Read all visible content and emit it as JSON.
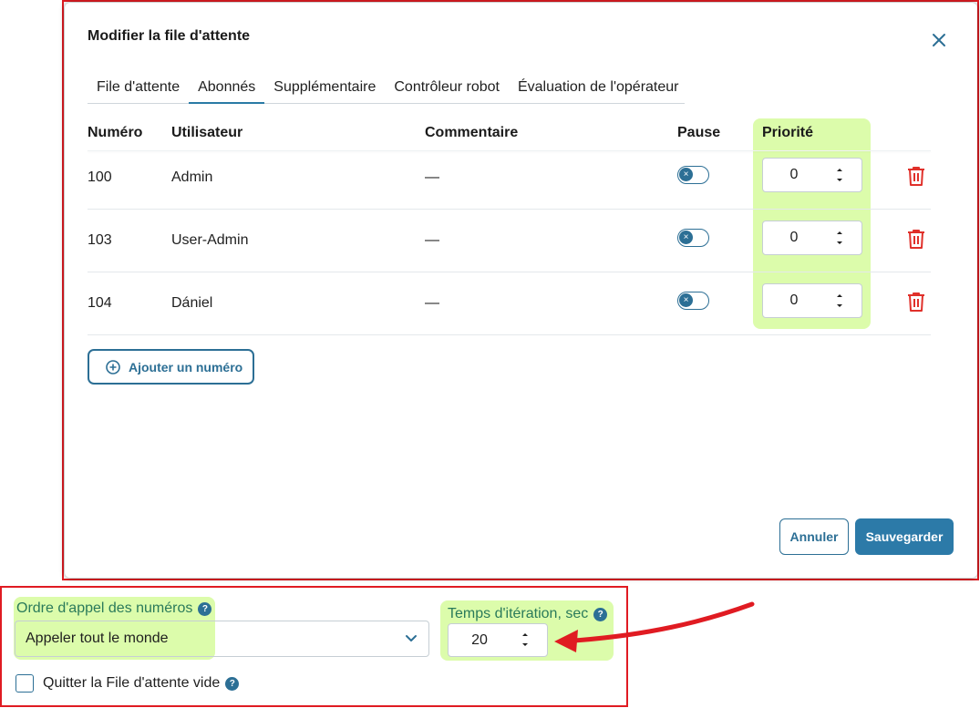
{
  "dialog": {
    "title": "Modifier la file d'attente",
    "tabs": [
      {
        "label": "File d'attente",
        "active": false
      },
      {
        "label": "Abonnés",
        "active": true
      },
      {
        "label": "Supplémentaire",
        "active": false
      },
      {
        "label": "Contrôleur robot",
        "active": false
      },
      {
        "label": "Évaluation de l'opérateur",
        "active": false
      }
    ],
    "table": {
      "headers": {
        "number": "Numéro",
        "user": "Utilisateur",
        "comment": "Commentaire",
        "pause": "Pause",
        "priority": "Priorité"
      },
      "rows": [
        {
          "number": "100",
          "user": "Admin",
          "comment": "—",
          "pause": false,
          "priority": "0"
        },
        {
          "number": "103",
          "user": "User-Admin",
          "comment": "—",
          "pause": false,
          "priority": "0"
        },
        {
          "number": "104",
          "user": "Dániel",
          "comment": "—",
          "pause": false,
          "priority": "0"
        }
      ]
    },
    "add_number_label": "Ajouter un numéro",
    "cancel_label": "Annuler",
    "save_label": "Sauvegarder"
  },
  "settings": {
    "call_order_label": "Ordre d'appel des numéros",
    "call_order_value": "Appeler tout le monde",
    "iteration_label": "Temps d'itération, sec",
    "iteration_value": "20",
    "quit_empty_label": "Quitter la File d'attente vide",
    "quit_empty_checked": false
  },
  "colors": {
    "accent": "#2c6f95",
    "primary_button": "#2c7aa8",
    "highlight": "#dcfcab",
    "annotation_red": "#e01b22",
    "delete_icon": "#e0302a",
    "label_green": "#2a7a5a"
  }
}
